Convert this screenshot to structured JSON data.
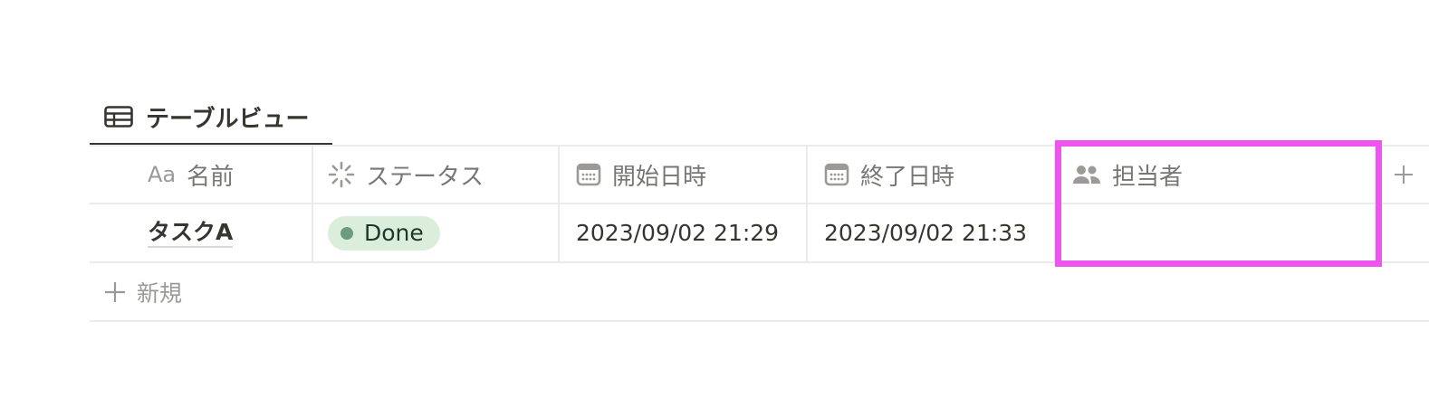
{
  "view": {
    "tab_label": "テーブルビュー",
    "tab_icon": "table-icon"
  },
  "table": {
    "columns": [
      {
        "key": "name",
        "label": "名前",
        "icon": "text-aa-icon",
        "icon_text": "Aa"
      },
      {
        "key": "status",
        "label": "ステータス",
        "icon": "status-spinner-icon"
      },
      {
        "key": "start",
        "label": "開始日時",
        "icon": "calendar-icon"
      },
      {
        "key": "end",
        "label": "終了日時",
        "icon": "calendar-icon"
      },
      {
        "key": "assignee",
        "label": "担当者",
        "icon": "people-icon"
      }
    ],
    "add_column_icon": "plus-icon",
    "rows": [
      {
        "name": "タスクA",
        "status": "Done",
        "start": "2023/09/02 21:29",
        "end": "2023/09/02 21:33",
        "assignee": ""
      }
    ],
    "new_row_label": "新規"
  },
  "colors": {
    "status_done_bg": "#dbeddb",
    "status_done_dot": "#6c9b7d",
    "highlight": "#ee55ee",
    "text": "#37352f",
    "muted": "#787774"
  }
}
